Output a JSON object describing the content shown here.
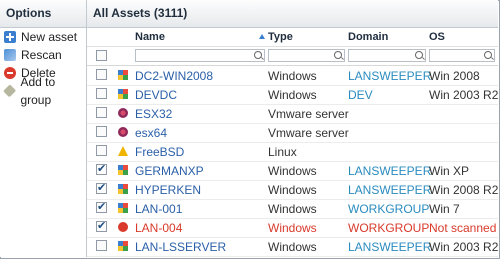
{
  "options": {
    "title": "Options",
    "items": [
      {
        "label": "New asset",
        "icon": "plus-icon"
      },
      {
        "label": "Rescan",
        "icon": "rescan-icon"
      },
      {
        "label": "Delete",
        "icon": "delete-icon"
      },
      {
        "label": "Add to group",
        "icon": "tag-icon"
      }
    ]
  },
  "grid": {
    "title": "All Assets (3111)",
    "columns": {
      "name": "Name",
      "type": "Type",
      "domain": "Domain",
      "os": "OS"
    },
    "sort": {
      "column": "Type",
      "direction": "ascending"
    },
    "rows": [
      {
        "name": "DC2-WIN2008",
        "type": "Windows",
        "domain": "LANSWEEPER",
        "os": "Win 2008",
        "checked": false,
        "icon": "windows-icon",
        "error": false
      },
      {
        "name": "DEVDC",
        "type": "Windows",
        "domain": "DEV",
        "os": "Win 2003 R2",
        "checked": false,
        "icon": "windows-icon",
        "error": false
      },
      {
        "name": "ESX32",
        "type": "Vmware server",
        "domain": "",
        "os": "",
        "checked": false,
        "icon": "vmware-icon",
        "error": false
      },
      {
        "name": "esx64",
        "type": "Vmware server",
        "domain": "",
        "os": "",
        "checked": false,
        "icon": "vmware-icon",
        "error": false
      },
      {
        "name": "FreeBSD",
        "type": "Linux",
        "domain": "",
        "os": "",
        "checked": false,
        "icon": "bsd-icon",
        "error": false
      },
      {
        "name": "GERMANXP",
        "type": "Windows",
        "domain": "LANSWEEPER",
        "os": "Win XP",
        "checked": true,
        "icon": "windows-icon",
        "error": false
      },
      {
        "name": "HYPERKEN",
        "type": "Windows",
        "domain": "LANSWEEPER",
        "os": "Win 2008 R2",
        "checked": true,
        "icon": "windows-icon",
        "error": false
      },
      {
        "name": "LAN-001",
        "type": "Windows",
        "domain": "WORKGROUP",
        "os": "Win 7",
        "checked": true,
        "icon": "windows-icon",
        "error": false
      },
      {
        "name": "LAN-004",
        "type": "Windows",
        "domain": "WORKGROUP",
        "os": "Not scanned",
        "checked": true,
        "icon": "error-icon",
        "error": true
      },
      {
        "name": "LAN-LSSERVER",
        "type": "Windows",
        "domain": "LANSWEEPER",
        "os": "Win 2003 R2",
        "checked": false,
        "icon": "windows-icon",
        "error": false
      }
    ]
  }
}
